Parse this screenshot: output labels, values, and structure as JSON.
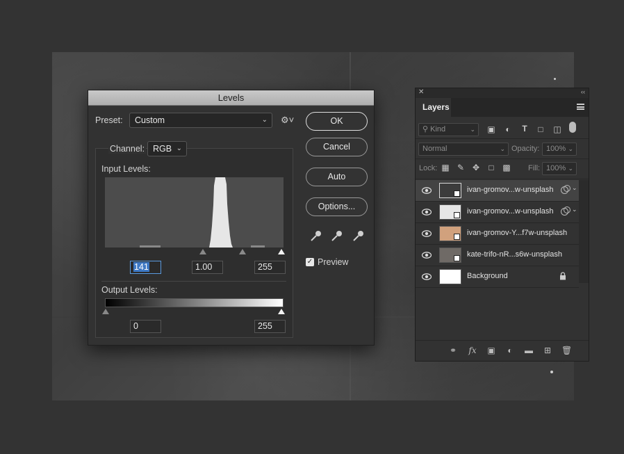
{
  "levels_dialog": {
    "title": "Levels",
    "preset_label": "Preset:",
    "preset_value": "Custom",
    "channel_label": "Channel:",
    "channel_value": "RGB",
    "input_levels_label": "Input Levels:",
    "input_black": "141",
    "input_gamma": "1.00",
    "input_white": "255",
    "output_levels_label": "Output Levels:",
    "output_black": "0",
    "output_white": "255",
    "buttons": {
      "ok": "OK",
      "cancel": "Cancel",
      "auto": "Auto",
      "options": "Options..."
    },
    "preview_label": "Preview",
    "preview_checked": true
  },
  "layers_panel": {
    "tab_label": "Layers",
    "filter_kind": "Kind",
    "blend_mode": "Normal",
    "opacity_label": "Opacity:",
    "opacity_value": "100%",
    "lock_label": "Lock:",
    "fill_label": "Fill:",
    "fill_value": "100%",
    "layers": [
      {
        "name": "ivan-gromov...w-unsplash",
        "selected": true,
        "thumb": "#3c3c3c"
      },
      {
        "name": "ivan-gromov...w-unsplash",
        "selected": false,
        "thumb": "#e6e6e6"
      },
      {
        "name": "ivan-gromov-Y...f7w-unsplash",
        "selected": false,
        "thumb": "#d1a17d"
      },
      {
        "name": "kate-trifo-nR...s6w-unsplash",
        "selected": false,
        "thumb": "#6f6a66"
      },
      {
        "name": "Background",
        "selected": false,
        "thumb": "#ffffff"
      }
    ]
  },
  "colors": {
    "app_bg": "#333333",
    "panel_bg": "#323232",
    "selection": "#3d78c4"
  }
}
